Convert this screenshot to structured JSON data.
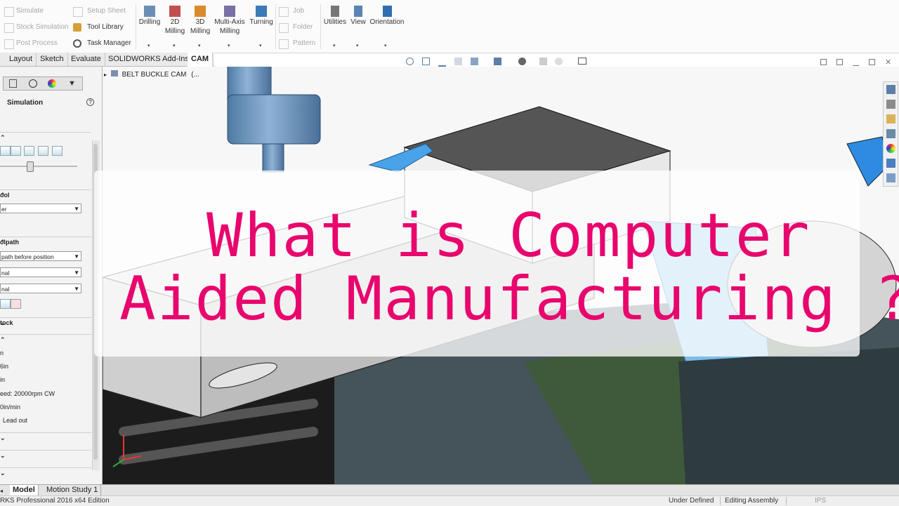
{
  "ribbon": {
    "col1": [
      "Simulate",
      "Stock Simulation",
      "Post Process"
    ],
    "col2": [
      "Setup Sheet",
      "Tool Library",
      "Task Manager"
    ],
    "big": [
      {
        "label_l1": "Drilling",
        "label_l2": ""
      },
      {
        "label_l1": "2D",
        "label_l2": "Milling"
      },
      {
        "label_l1": "3D",
        "label_l2": "Milling"
      },
      {
        "label_l1": "Multi-Axis",
        "label_l2": "Milling"
      },
      {
        "label_l1": "Turning",
        "label_l2": ""
      }
    ],
    "col3": [
      "Job",
      "Folder",
      "Pattern"
    ],
    "big2": [
      {
        "label": "Utilities"
      },
      {
        "label": "View"
      },
      {
        "label": "Orientation"
      }
    ]
  },
  "tabs": [
    "Layout",
    "Sketch",
    "Evaluate",
    "SOLIDWORKS Add-Ins",
    "CAM"
  ],
  "tree": {
    "label": "BELT BUCKLE CAM",
    "suffix": "(..."
  },
  "panel": {
    "title": "Simulation",
    "sections": {
      "tool": "ool",
      "tool_select": "er",
      "toolpath": "olpath",
      "toolpath_select1": "path before position",
      "toolpath_select2": "nal",
      "toolpath_select3": "nal",
      "stock": "tock"
    },
    "info": [
      "n",
      "6in",
      "in",
      "eed: 20000rpm CW",
      "0in/min",
      "Lead out"
    ]
  },
  "overlay": {
    "line1": "What is Computer",
    "line2": "Aided Manufacturing  ?"
  },
  "bottom_tabs": [
    "Model",
    "Motion Study 1"
  ],
  "status": {
    "edition": "RKS Professional 2016 x64 Edition",
    "defined": "Under Defined",
    "mode": "Editing Assembly",
    "units": "IPS"
  },
  "colors": {
    "accent": "#e8066e",
    "tool_blue": "#6f95b8",
    "fixture_gray": "#c8c8c8",
    "bed_dark": "#2e3b3f",
    "bed_green": "#4e6e3a"
  }
}
